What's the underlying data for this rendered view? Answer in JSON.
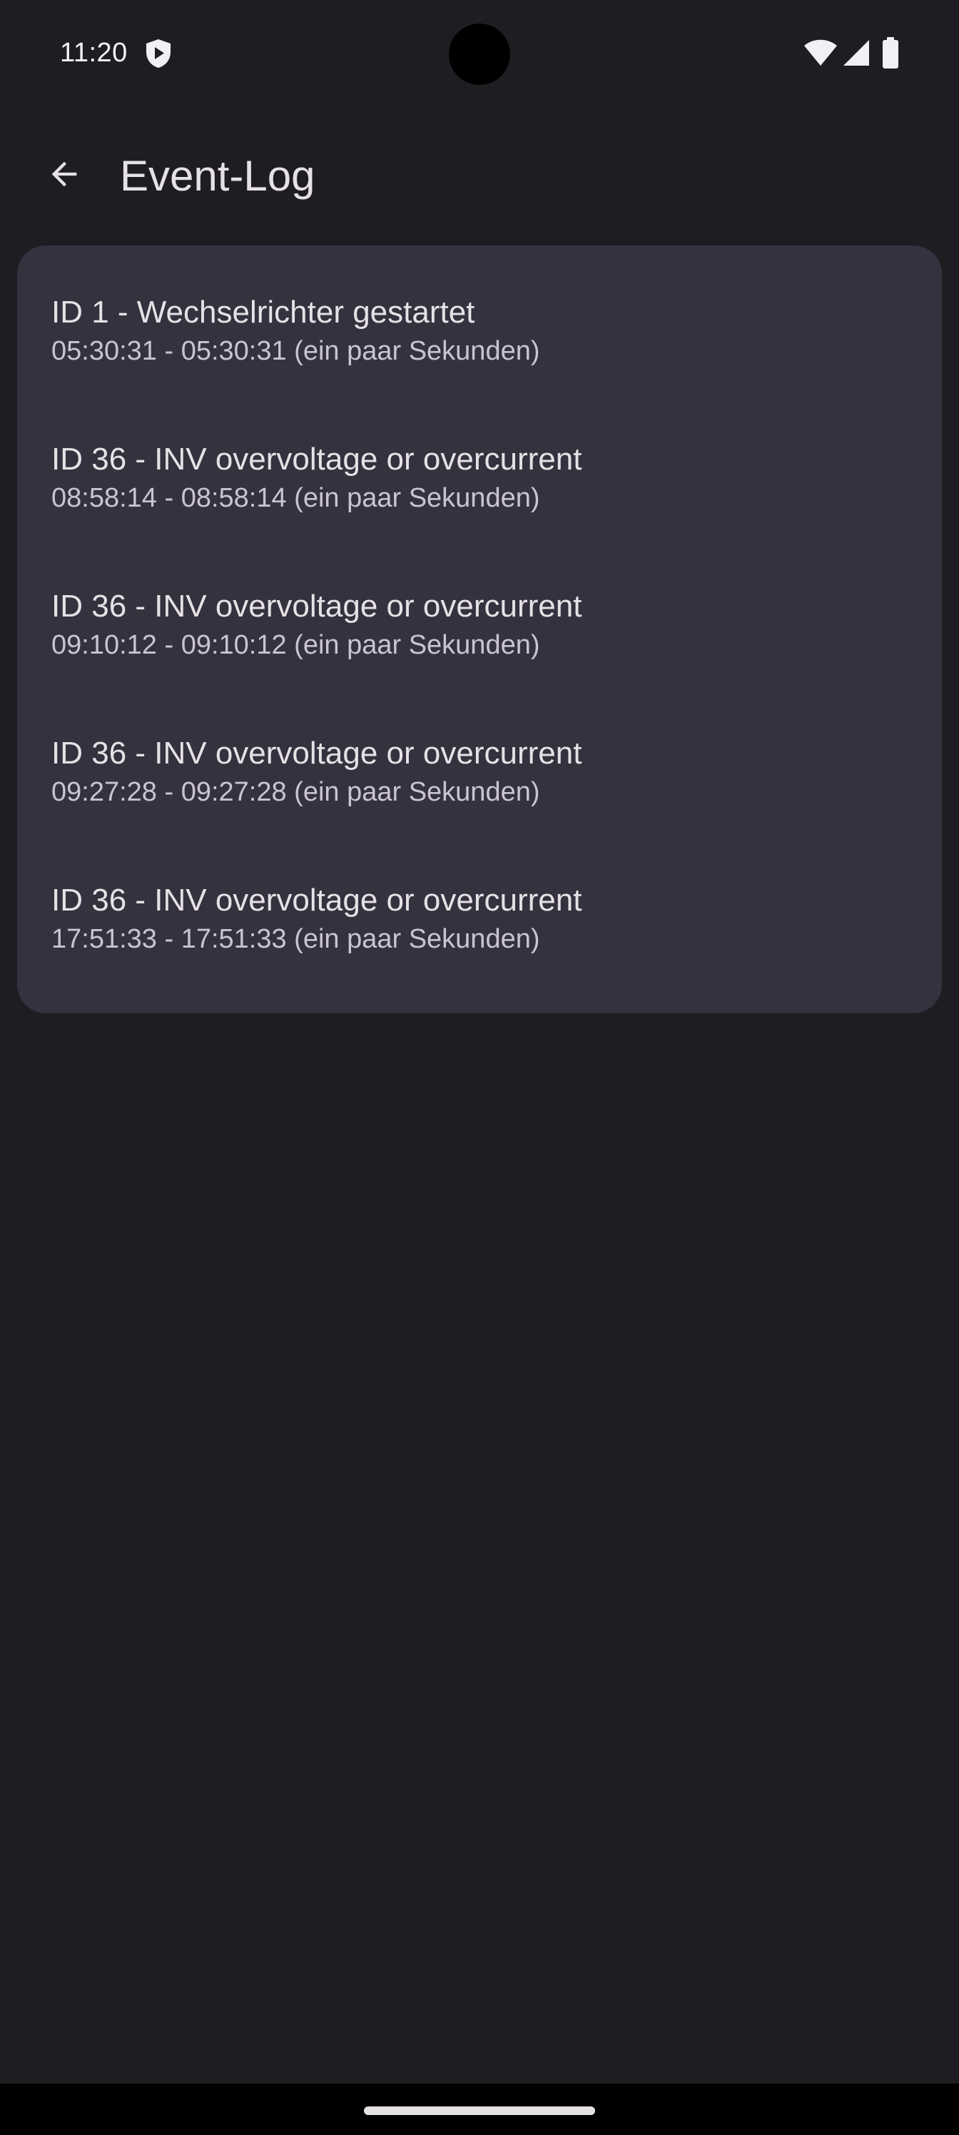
{
  "status_bar": {
    "time": "11:20",
    "icons": [
      "shield-icon",
      "wifi-icon",
      "signal-icon",
      "battery-icon"
    ]
  },
  "app_bar": {
    "back_icon": "arrow-back-icon",
    "title": "Event-Log"
  },
  "events": [
    {
      "title": "ID 1 - Wechselrichter gestartet",
      "time": "05:30:31 - 05:30:31 (ein paar Sekunden)"
    },
    {
      "title": "ID 36 - INV overvoltage or overcurrent",
      "time": "08:58:14 - 08:58:14 (ein paar Sekunden)"
    },
    {
      "title": "ID 36 - INV overvoltage or overcurrent",
      "time": "09:10:12 - 09:10:12 (ein paar Sekunden)"
    },
    {
      "title": "ID 36 - INV overvoltage or overcurrent",
      "time": "09:27:28 - 09:27:28 (ein paar Sekunden)"
    },
    {
      "title": "ID 36 - INV overvoltage or overcurrent",
      "time": "17:51:33 - 17:51:33 (ein paar Sekunden)"
    }
  ],
  "colors": {
    "background": "#1e1d22",
    "card": "#34323f",
    "primary_text": "#e6e1e5",
    "secondary_text": "#cac4d0"
  }
}
